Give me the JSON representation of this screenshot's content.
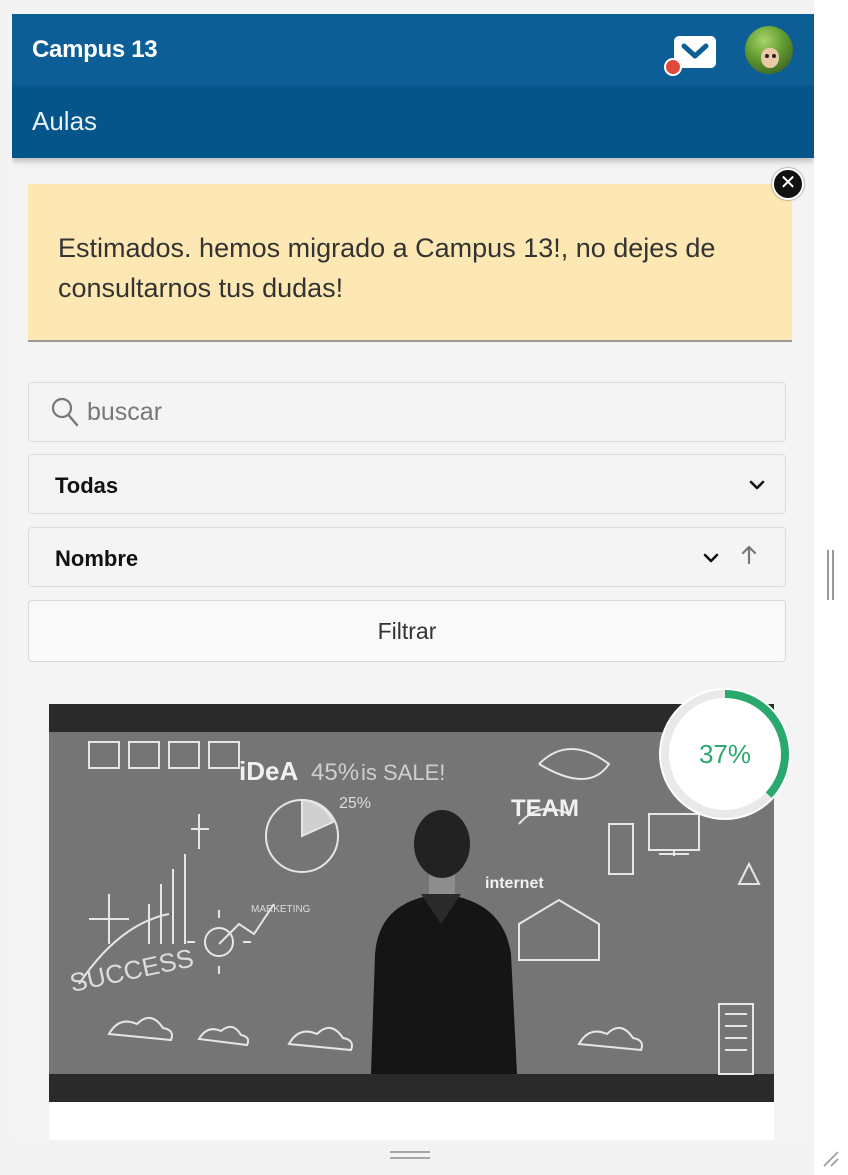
{
  "header": {
    "app_title": "Campus 13",
    "messages_icon": "envelope-check-icon",
    "notification_color": "#e04a3a",
    "avatar_icon": "user-avatar",
    "brand_color": "#0d5e96"
  },
  "subheader": {
    "title": "Aulas"
  },
  "notice": {
    "text": "Estimados. hemos migrado a Campus 13!, no dejes de consultarnos tus dudas!",
    "background": "#fde8b3",
    "close_icon": "close-icon"
  },
  "filters": {
    "search_placeholder": "buscar",
    "category_select": "Todas",
    "sort_select": "Nombre",
    "sort_direction_icon": "arrow-up-icon",
    "filter_button": "Filtrar"
  },
  "courses": [
    {
      "progress_label": "37%",
      "progress_fraction": 0.37,
      "progress_color": "#2aa96e",
      "image_text": [
        "iDeA",
        "45%",
        "is SALE!",
        "25%",
        "TEAM",
        "internet",
        "MARKETING",
        "SUCCESS"
      ]
    }
  ]
}
